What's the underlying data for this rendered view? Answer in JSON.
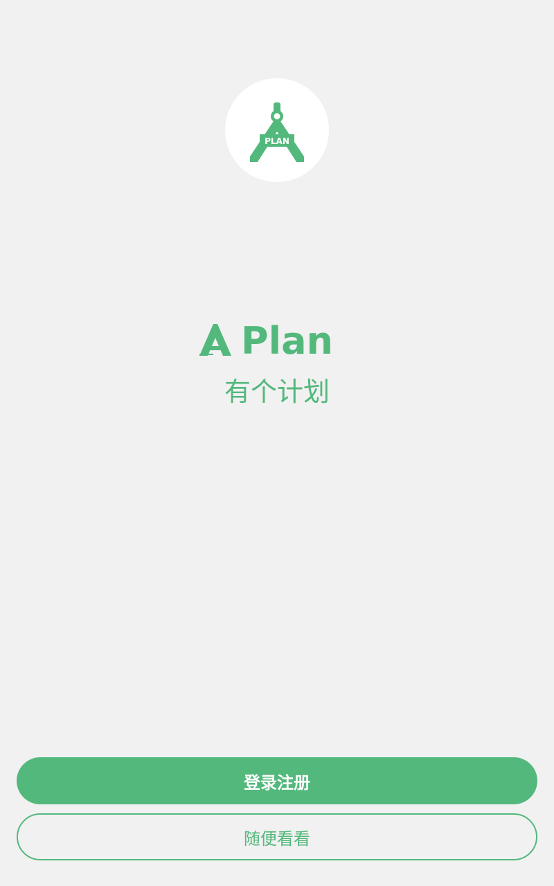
{
  "brand": {
    "name": "Plan",
    "logo_text": "PLAN",
    "tagline": "有个计划",
    "color": "#53b87c"
  },
  "actions": {
    "login_register": "登录注册",
    "browse": "随便看看"
  }
}
